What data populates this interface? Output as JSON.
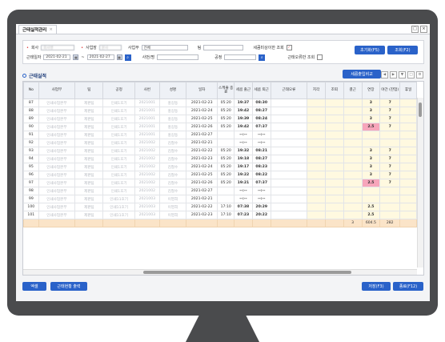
{
  "tab": {
    "title": "근태실적관리",
    "close": "×"
  },
  "window": {
    "restore": "□",
    "close": "×"
  },
  "filters": {
    "company_label": "회사",
    "company_value": "회사명",
    "business_label": "사업장",
    "business_value": "본사",
    "dept_label": "사업부",
    "dept_value": "전체",
    "team_label": "팀",
    "team_value": "",
    "abnormal_label": "세콤미상이한 조회",
    "date_label": "근태일자",
    "date_from": "2021-02-21",
    "date_to": "2021-02-27",
    "date_sep": "~",
    "emp_label": "사번/명",
    "site_label": "공정",
    "error_label": "근태오류만 조회",
    "init_button": "초기화(F5)",
    "search_button": "조회(F2)"
  },
  "section": {
    "title": "근태실적",
    "secom_button": "세콤출입비교"
  },
  "grid": {
    "headers": [
      "No",
      "사업부",
      "팀",
      "공정",
      "사번",
      "성명",
      "일자",
      "스케줄 종료",
      "세콤 출근",
      "세콤 퇴근",
      "근태오류",
      "지각",
      "조퇴",
      "결근",
      "연장",
      "야간 (잔업)",
      "휴일"
    ],
    "rows": [
      {
        "no": "87",
        "dept": "인쇄사업본부",
        "team": "제판팀",
        "proc": "인쇄1호기",
        "emp": "2021001",
        "name": "홍길동",
        "date": "2021-02-23",
        "sched": "05:20",
        "in": "19:37",
        "out": "08:30",
        "err": "",
        "late": "",
        "early": "",
        "absent": "",
        "ext": "3",
        "night": "7",
        "hol": "",
        "pink": false
      },
      {
        "no": "88",
        "dept": "인쇄사업본부",
        "team": "제판팀",
        "proc": "인쇄1호기",
        "emp": "2021001",
        "name": "홍길동",
        "date": "2021-02-24",
        "sched": "05:20",
        "in": "19:42",
        "out": "08:27",
        "err": "",
        "late": "",
        "early": "",
        "absent": "",
        "ext": "3",
        "night": "7",
        "hol": "",
        "pink": false
      },
      {
        "no": "89",
        "dept": "인쇄사업본부",
        "team": "제판팀",
        "proc": "인쇄1호기",
        "emp": "2021001",
        "name": "홍길동",
        "date": "2021-02-25",
        "sched": "05:20",
        "in": "19:39",
        "out": "08:24",
        "err": "",
        "late": "",
        "early": "",
        "absent": "",
        "ext": "3",
        "night": "7",
        "hol": "",
        "pink": false
      },
      {
        "no": "90",
        "dept": "인쇄사업본부",
        "team": "제판팀",
        "proc": "인쇄1호기",
        "emp": "2021001",
        "name": "홍길동",
        "date": "2021-02-26",
        "sched": "05:20",
        "in": "19:42",
        "out": "07:37",
        "err": "",
        "late": "",
        "early": "",
        "absent": "",
        "ext": "2.5",
        "night": "7",
        "hol": "",
        "pink": true
      },
      {
        "no": "91",
        "dept": "인쇄사업본부",
        "team": "제판팀",
        "proc": "인쇄1호기",
        "emp": "2021001",
        "name": "홍길동",
        "date": "2021-02-27",
        "sched": "",
        "in": "--:--",
        "out": "--:--",
        "err": "",
        "late": "",
        "early": "",
        "absent": "",
        "ext": "",
        "night": "",
        "hol": "",
        "pink": false
      },
      {
        "no": "92",
        "dept": "인쇄사업본부",
        "team": "제판팀",
        "proc": "인쇄1호기",
        "emp": "2021002",
        "name": "김철수",
        "date": "2021-02-21",
        "sched": "",
        "in": "--:--",
        "out": "--:--",
        "err": "",
        "late": "",
        "early": "",
        "absent": "",
        "ext": "",
        "night": "",
        "hol": "",
        "pink": false
      },
      {
        "no": "93",
        "dept": "인쇄사업본부",
        "team": "제판팀",
        "proc": "인쇄1호기",
        "emp": "2021002",
        "name": "김철수",
        "date": "2021-02-22",
        "sched": "05:20",
        "in": "19:32",
        "out": "08:21",
        "err": "",
        "late": "",
        "early": "",
        "absent": "",
        "ext": "3",
        "night": "7",
        "hol": "",
        "pink": false
      },
      {
        "no": "94",
        "dept": "인쇄사업본부",
        "team": "제판팀",
        "proc": "인쇄1호기",
        "emp": "2021002",
        "name": "김철수",
        "date": "2021-02-23",
        "sched": "05:20",
        "in": "19:18",
        "out": "08:27",
        "err": "",
        "late": "",
        "early": "",
        "absent": "",
        "ext": "3",
        "night": "7",
        "hol": "",
        "pink": false
      },
      {
        "no": "95",
        "dept": "인쇄사업본부",
        "team": "제판팀",
        "proc": "인쇄1호기",
        "emp": "2021002",
        "name": "김철수",
        "date": "2021-02-24",
        "sched": "05:20",
        "in": "19:17",
        "out": "08:23",
        "err": "",
        "late": "",
        "early": "",
        "absent": "",
        "ext": "3",
        "night": "7",
        "hol": "",
        "pink": false
      },
      {
        "no": "96",
        "dept": "인쇄사업본부",
        "team": "제판팀",
        "proc": "인쇄1호기",
        "emp": "2021002",
        "name": "김철수",
        "date": "2021-02-25",
        "sched": "05:20",
        "in": "19:22",
        "out": "08:22",
        "err": "",
        "late": "",
        "early": "",
        "absent": "",
        "ext": "3",
        "night": "7",
        "hol": "",
        "pink": false
      },
      {
        "no": "97",
        "dept": "인쇄사업본부",
        "team": "제판팀",
        "proc": "인쇄1호기",
        "emp": "2021002",
        "name": "김철수",
        "date": "2021-02-26",
        "sched": "05:20",
        "in": "19:21",
        "out": "07:37",
        "err": "",
        "late": "",
        "early": "",
        "absent": "",
        "ext": "2.5",
        "night": "7",
        "hol": "",
        "pink": true
      },
      {
        "no": "98",
        "dept": "인쇄사업본부",
        "team": "제판팀",
        "proc": "인쇄1호기",
        "emp": "2021002",
        "name": "김철수",
        "date": "2021-02-27",
        "sched": "",
        "in": "--:--",
        "out": "--:--",
        "err": "",
        "late": "",
        "early": "",
        "absent": "",
        "ext": "",
        "night": "",
        "hol": "",
        "pink": false
      },
      {
        "no": "99",
        "dept": "인쇄사업본부",
        "team": "제판팀",
        "proc": "인쇄11호기",
        "emp": "2021003",
        "name": "이영희",
        "date": "2021-02-21",
        "sched": "",
        "in": "--:--",
        "out": "--:--",
        "err": "",
        "late": "",
        "early": "",
        "absent": "",
        "ext": "",
        "night": "",
        "hol": "",
        "pink": false
      },
      {
        "no": "100",
        "dept": "인쇄사업본부",
        "team": "제판팀",
        "proc": "인쇄11호기",
        "emp": "2021003",
        "name": "이영희",
        "date": "2021-02-22",
        "sched": "17:10",
        "in": "07:38",
        "out": "20:29",
        "err": "",
        "late": "",
        "early": "",
        "absent": "",
        "ext": "2.5",
        "night": "",
        "hol": "",
        "pink": false
      },
      {
        "no": "101",
        "dept": "인쇄사업본부",
        "team": "제판팀",
        "proc": "인쇄11호기",
        "emp": "2021003",
        "name": "이영희",
        "date": "2021-02-23",
        "sched": "17:10",
        "in": "07:23",
        "out": "20:22",
        "err": "",
        "late": "",
        "early": "",
        "absent": "",
        "ext": "2.5",
        "night": "",
        "hol": "",
        "pink": false
      }
    ],
    "summary": {
      "absent": "3",
      "ext": "604.5",
      "night": "282"
    }
  },
  "footer": {
    "excel_button": "엑셀",
    "report_button": "근태현황 출력",
    "save_button": "저장(F3)",
    "exit_button": "종료(F12)"
  },
  "colors": {
    "accent": "#2a62c9",
    "pink": "#f7a6bb",
    "summary": "#fbe4c8"
  }
}
